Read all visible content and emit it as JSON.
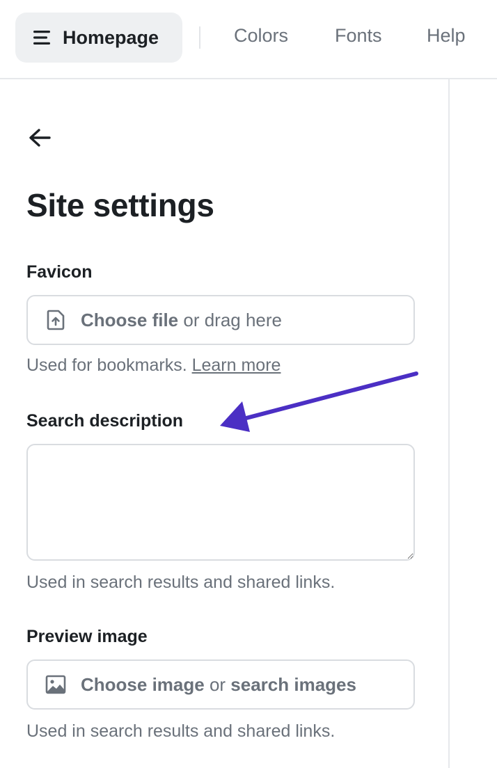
{
  "nav": {
    "home_label": "Homepage",
    "home_icon": "menu-icon",
    "links": [
      "Colors",
      "Fonts",
      "Help"
    ]
  },
  "page": {
    "back_icon": "arrow-left-icon",
    "title": "Site settings"
  },
  "favicon": {
    "label": "Favicon",
    "upload_icon": "file-upload-icon",
    "action_strong": "Choose file",
    "action_rest": " or drag here",
    "hint": "Used for bookmarks. ",
    "hint_link": "Learn more"
  },
  "search_description": {
    "label": "Search description",
    "value": "",
    "hint": "Used in search results and shared links."
  },
  "preview_image": {
    "label": "Preview image",
    "upload_icon": "image-icon",
    "action_strong": "Choose image",
    "action_mid": " or ",
    "action_strong2": "search images",
    "hint": "Used in search results and shared links."
  },
  "annotation": {
    "arrow_color": "#4b2fc4",
    "arrow_icon": "annotation-arrow-icon"
  },
  "colors": {
    "text": "#1c2024",
    "muted": "#6a717a",
    "border": "#d9dce0",
    "nav_active_bg": "#eef0f2"
  }
}
